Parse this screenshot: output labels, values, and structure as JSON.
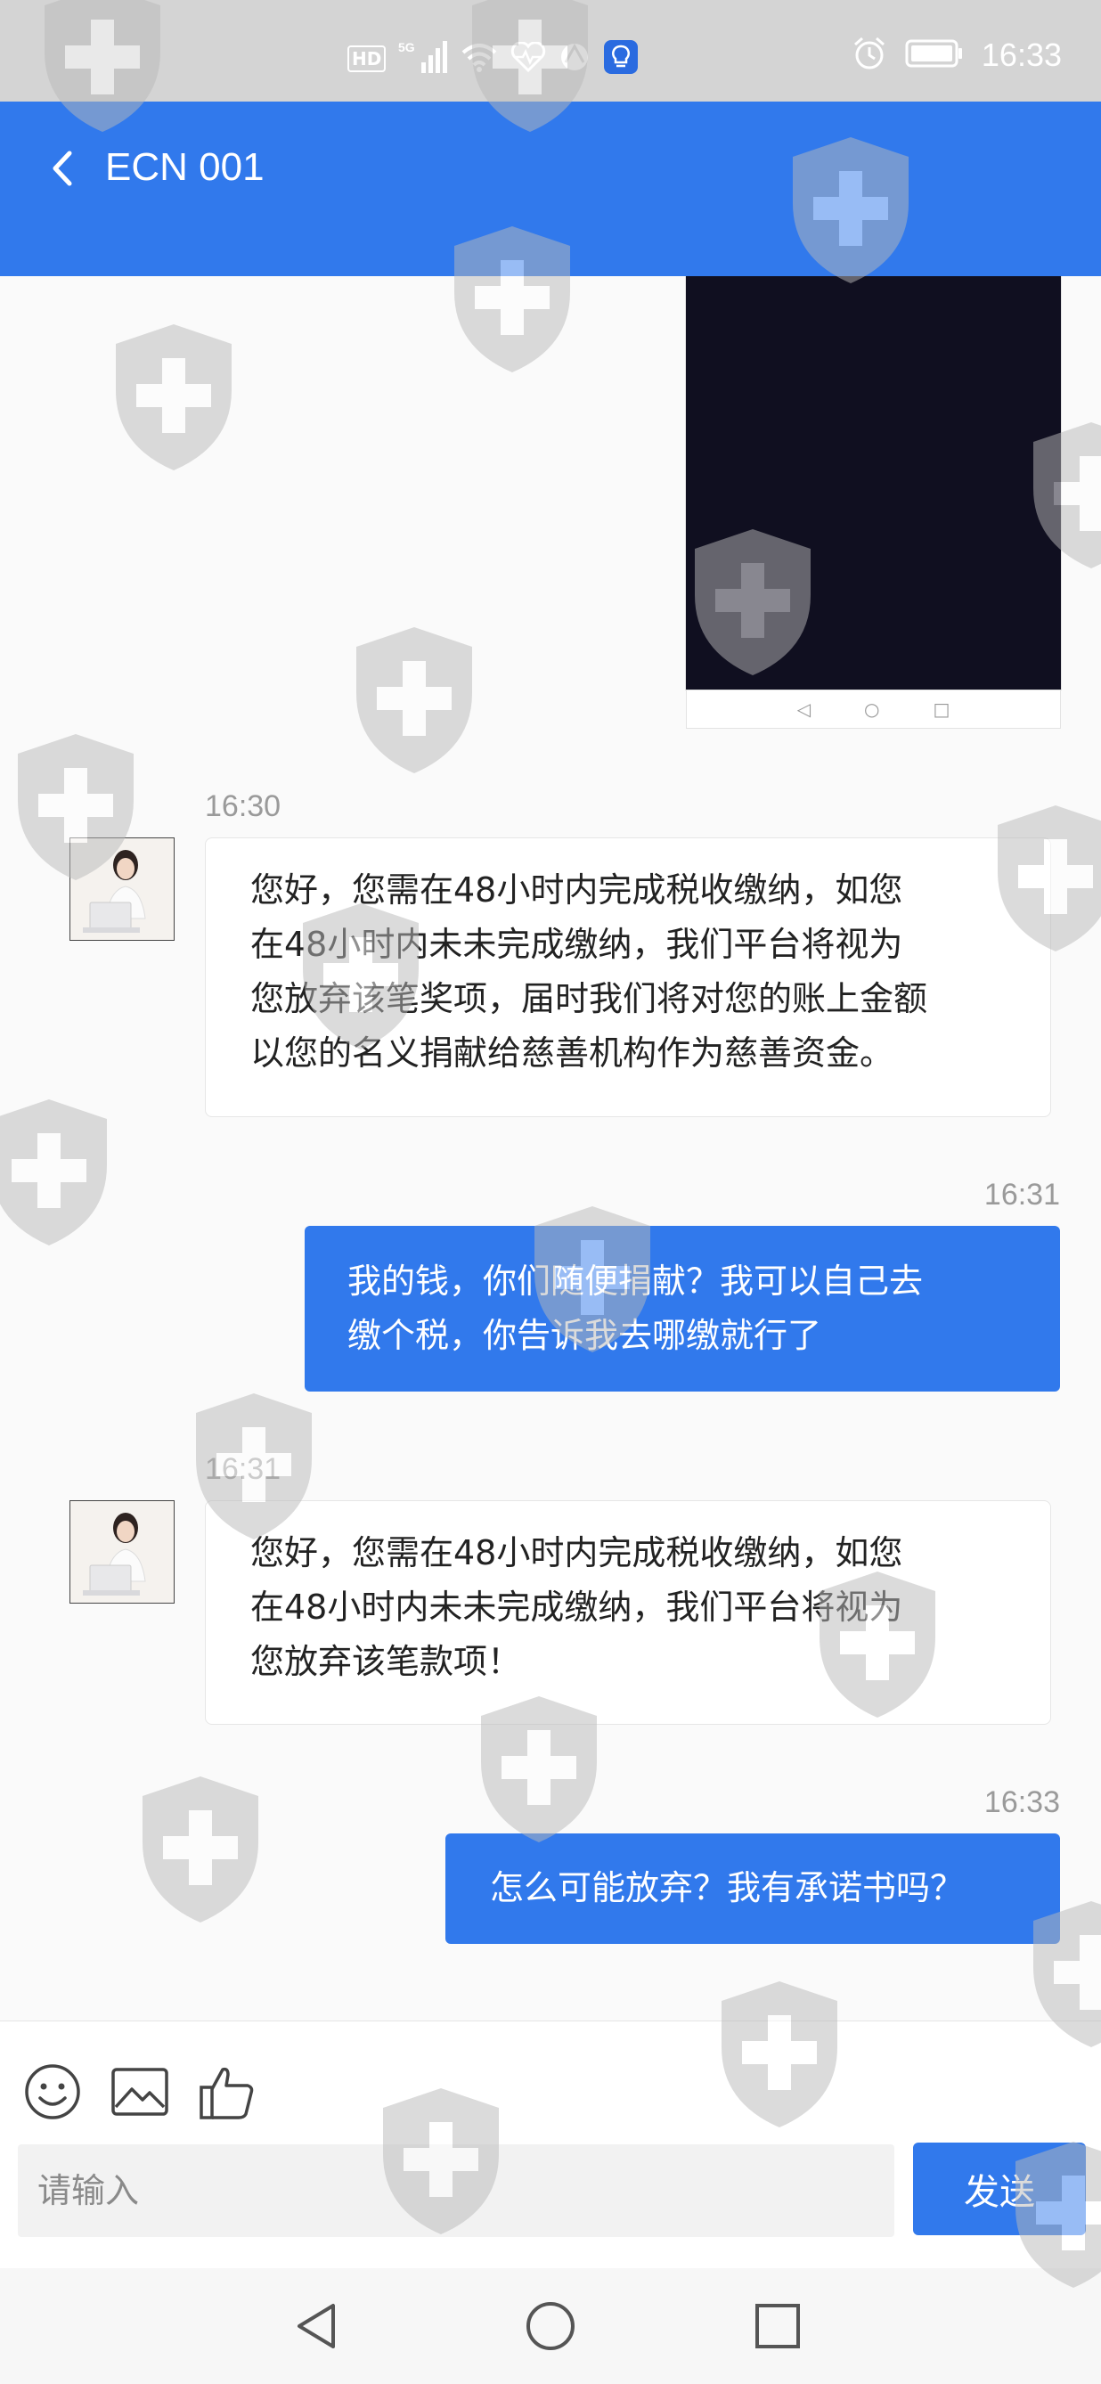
{
  "status_bar": {
    "hd": "HD",
    "network": "5G",
    "time": "16:33"
  },
  "header": {
    "title": "ECN 001"
  },
  "messages": [
    {
      "side": "in",
      "time": "16:30",
      "text": "您好，您需在48小时内完成税收缴纳，如您\n在48小时内未未完成缴纳，我们平台将视为\n您放弃该笔奖项，届时我们将对您的账上金额\n以您的名义捐献给慈善机构作为慈善资金。"
    },
    {
      "side": "out",
      "time": "16:31",
      "text": "我的钱，你们随便捐献？我可以自己去\n缴个税，你告诉我去哪缴就行了"
    },
    {
      "side": "in",
      "time": "16:31",
      "text": "您好，您需在48小时内完成税收缴纳，如您\n在48小时内未未完成缴纳，我们平台将视为\n您放弃该笔款项！"
    },
    {
      "side": "out",
      "time": "16:33",
      "text": "怎么可能放弃？我有承诺书吗？"
    }
  ],
  "input": {
    "placeholder": "请输入",
    "send_label": "发送"
  },
  "icons": {
    "emoji": "emoji-icon",
    "image": "image-icon",
    "like": "thumbs-up-icon"
  },
  "colors": {
    "brand": "#3179ec",
    "video_bg": "#100f20"
  }
}
